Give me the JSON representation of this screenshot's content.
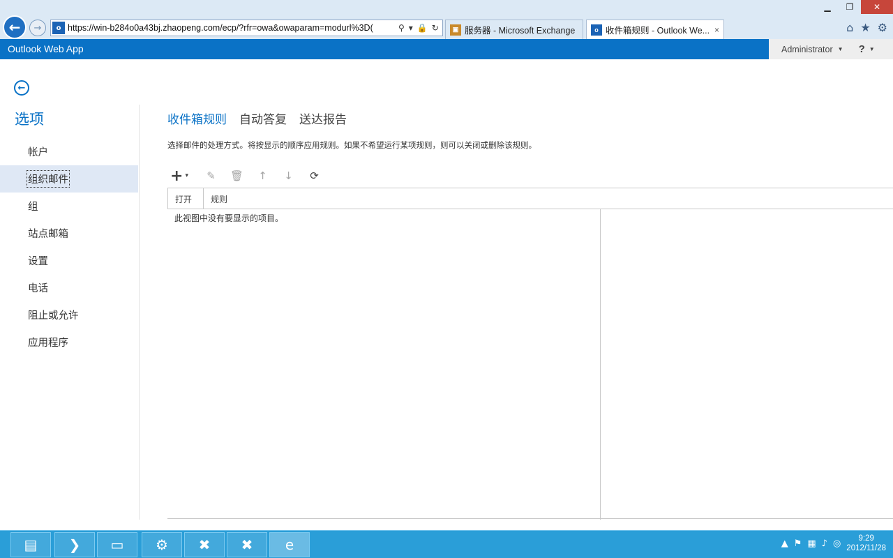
{
  "browser": {
    "url": "https://win-b284o0a43bj.zhaopeng.com/ecp/?rfr=owa&owaparam=modurl%3D(",
    "site_icon": "o",
    "tabs": [
      {
        "label": "服务器 - Microsoft Exchange",
        "icon": "exchange-icon",
        "active": false
      },
      {
        "label": "收件箱规则 - Outlook We...",
        "icon": "outlook-icon",
        "active": true
      }
    ],
    "tab_close": "×",
    "window_buttons": {
      "minimize": "▁",
      "restore": "❐",
      "close": "✕"
    },
    "right_icons": [
      "home-icon",
      "favorites-star-icon",
      "settings-gear-icon"
    ]
  },
  "owa": {
    "app_title": "Outlook Web App",
    "user_name": "Administrator",
    "help": "?"
  },
  "sidebar": {
    "title": "选项",
    "items": [
      {
        "label": "帐户"
      },
      {
        "label": "组织邮件"
      },
      {
        "label": "组"
      },
      {
        "label": "站点邮箱"
      },
      {
        "label": "设置"
      },
      {
        "label": "电话"
      },
      {
        "label": "阻止或允许"
      },
      {
        "label": "应用程序"
      }
    ],
    "selected_index": 1
  },
  "content": {
    "tabs": [
      {
        "label": "收件箱规则",
        "active": true
      },
      {
        "label": "自动答复",
        "active": false
      },
      {
        "label": "送达报告",
        "active": false
      }
    ],
    "description": "选择邮件的处理方式。将按显示的顺序应用规则。如果不希望运行某项规则，则可以关闭或删除该规则。",
    "toolbar": {
      "add": "+",
      "add_dropdown": "▾",
      "edit": "✎",
      "delete": "🗑",
      "move_up": "↑",
      "move_down": "↓",
      "refresh": "⟳"
    },
    "grid": {
      "columns": [
        "打开",
        "规则"
      ],
      "empty_message": "此视图中没有要显示的项目。"
    }
  },
  "taskbar": {
    "apps": [
      "server-manager-icon",
      "powershell-icon",
      "file-explorer-icon",
      "task-scheduler-icon",
      "exchange-shell-icon",
      "exchange-toolbox-icon",
      "internet-explorer-icon"
    ],
    "clock_time": "9:29",
    "clock_date": "2012/11/28"
  }
}
